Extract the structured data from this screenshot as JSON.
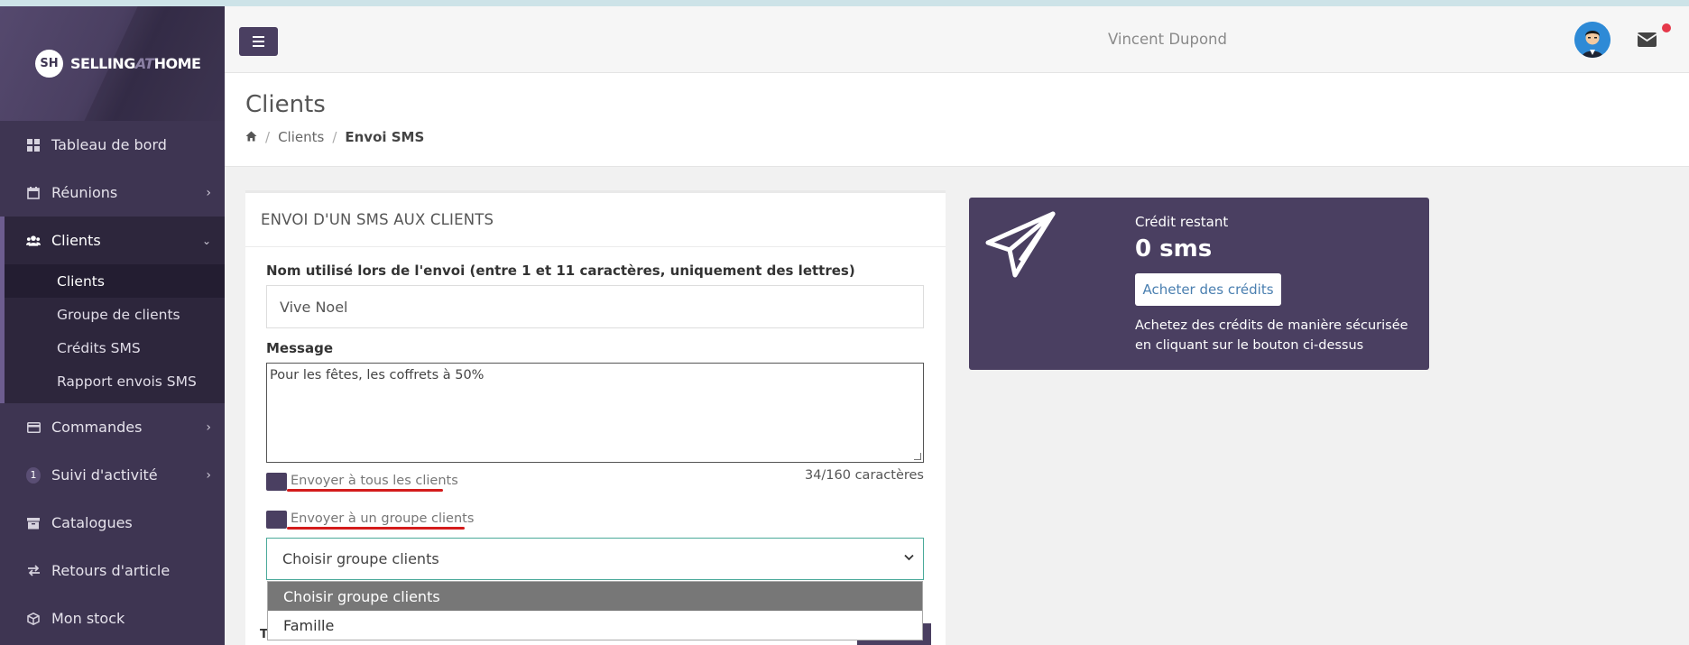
{
  "brand": {
    "logo_initials": "SH",
    "name_part1": "SELLING",
    "name_part2": "AT",
    "name_part3": "HOME"
  },
  "sidebar": {
    "items": [
      {
        "label": "Tableau de bord",
        "icon": "dashboard-icon"
      },
      {
        "label": "Réunions",
        "icon": "calendar-icon"
      },
      {
        "label": "Clients",
        "icon": "users-icon"
      },
      {
        "label": "Commandes",
        "icon": "credit-card-icon"
      },
      {
        "label": "Suivi d'activité",
        "icon": "badge-icon",
        "badge": "1"
      },
      {
        "label": "Catalogues",
        "icon": "archive-icon"
      },
      {
        "label": "Retours d'article",
        "icon": "exchange-icon"
      },
      {
        "label": "Mon stock",
        "icon": "cube-icon"
      }
    ],
    "clients_sub": [
      {
        "label": "Clients"
      },
      {
        "label": "Groupe de clients"
      },
      {
        "label": "Crédits SMS"
      },
      {
        "label": "Rapport envois SMS"
      }
    ]
  },
  "header": {
    "username": "Vincent Dupond"
  },
  "page": {
    "title": "Clients",
    "breadcrumb": [
      "Clients",
      "Envoi SMS"
    ]
  },
  "form": {
    "heading": "ENVOI D'UN SMS AUX CLIENTS",
    "sender_label": "Nom utilisé lors de l'envoi (entre 1 et 11 caractères, uniquement des lettres)",
    "sender_value": "Vive Noel",
    "message_label": "Message",
    "message_value": "Pour les fêtes, les coffrets à 50%",
    "char_count": "34/160 caractères",
    "send_all_label": "Envoyer à tous les clients",
    "send_group_label": "Envoyer à un groupe clients",
    "group_select": {
      "selected": "Choisir groupe clients",
      "options": [
        "Choisir groupe clients",
        "Famille"
      ]
    },
    "hidden_t": "T"
  },
  "credit": {
    "label": "Crédit restant",
    "value": "0 sms",
    "buy_button": "Acheter des crédits",
    "note": "Achetez des crédits de manière sécurisée en cliquant sur le bouton ci-dessus"
  },
  "colors": {
    "sidebar": "#3e3552",
    "accent": "#4a3f61",
    "annotation": "#d41b1b"
  }
}
